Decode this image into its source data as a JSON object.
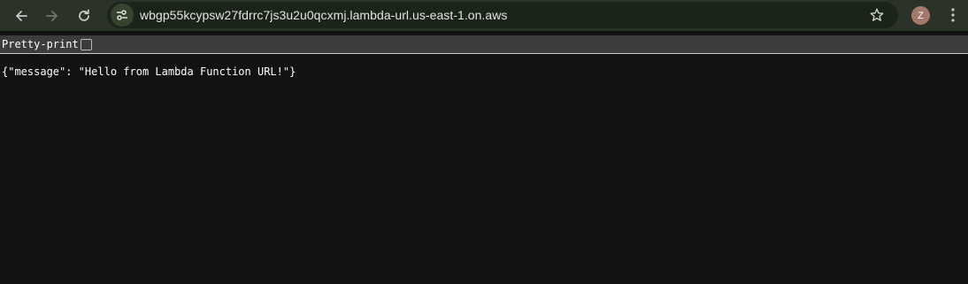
{
  "browser": {
    "url": "wbgp55kcypsw27fdrrc7js3u2u0qcxmj.lambda-url.us-east-1.on.aws",
    "profile_initial": "Z",
    "icons": {
      "back": "arrow-left-icon",
      "forward": "arrow-right-icon",
      "reload": "reload-icon",
      "site_info": "tune-icon",
      "bookmark": "star-icon",
      "menu": "kebab-menu-icon"
    },
    "colors": {
      "toolbar_bg": "#2b3227",
      "omnibox_bg": "#1b2418",
      "avatar_bg": "#a4776b",
      "page_bg": "#121212"
    }
  },
  "viewer": {
    "pretty_print_label": "Pretty-print",
    "pretty_print_checked": false,
    "body_text": "{\"message\": \"Hello from Lambda Function URL!\"}"
  }
}
